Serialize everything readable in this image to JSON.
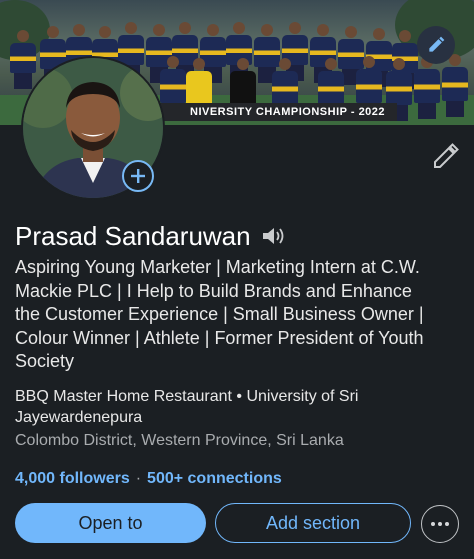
{
  "cover": {
    "banner_text": "NIVERSITY CHAMPIONSHIP - 2022"
  },
  "profile": {
    "name": "Prasad Sandaruwan",
    "headline_lines": [
      "Aspiring Young Marketer | Marketing Intern at C.W.",
      "Mackie PLC | I Help to Build Brands and Enhance",
      "the Customer Experience | Small Business Owner |",
      "Colour Winner | Athlete | Former President of Youth",
      "Society"
    ],
    "company_lines": [
      "BBQ Master Home Restaurant • University of Sri",
      "Jayewardenepura"
    ],
    "location": "Colombo District, Western Province, Sri Lanka",
    "followers": "4,000 followers",
    "separator": "·",
    "connections": "500+ connections"
  },
  "actions": {
    "open_to": "Open to",
    "add_section": "Add section"
  },
  "colors": {
    "background": "#1b1f23",
    "accent": "#71b7fb",
    "muted": "#a9acaf"
  },
  "icons": [
    "pencil-icon",
    "plus-icon",
    "speaker-icon",
    "more-icon"
  ]
}
